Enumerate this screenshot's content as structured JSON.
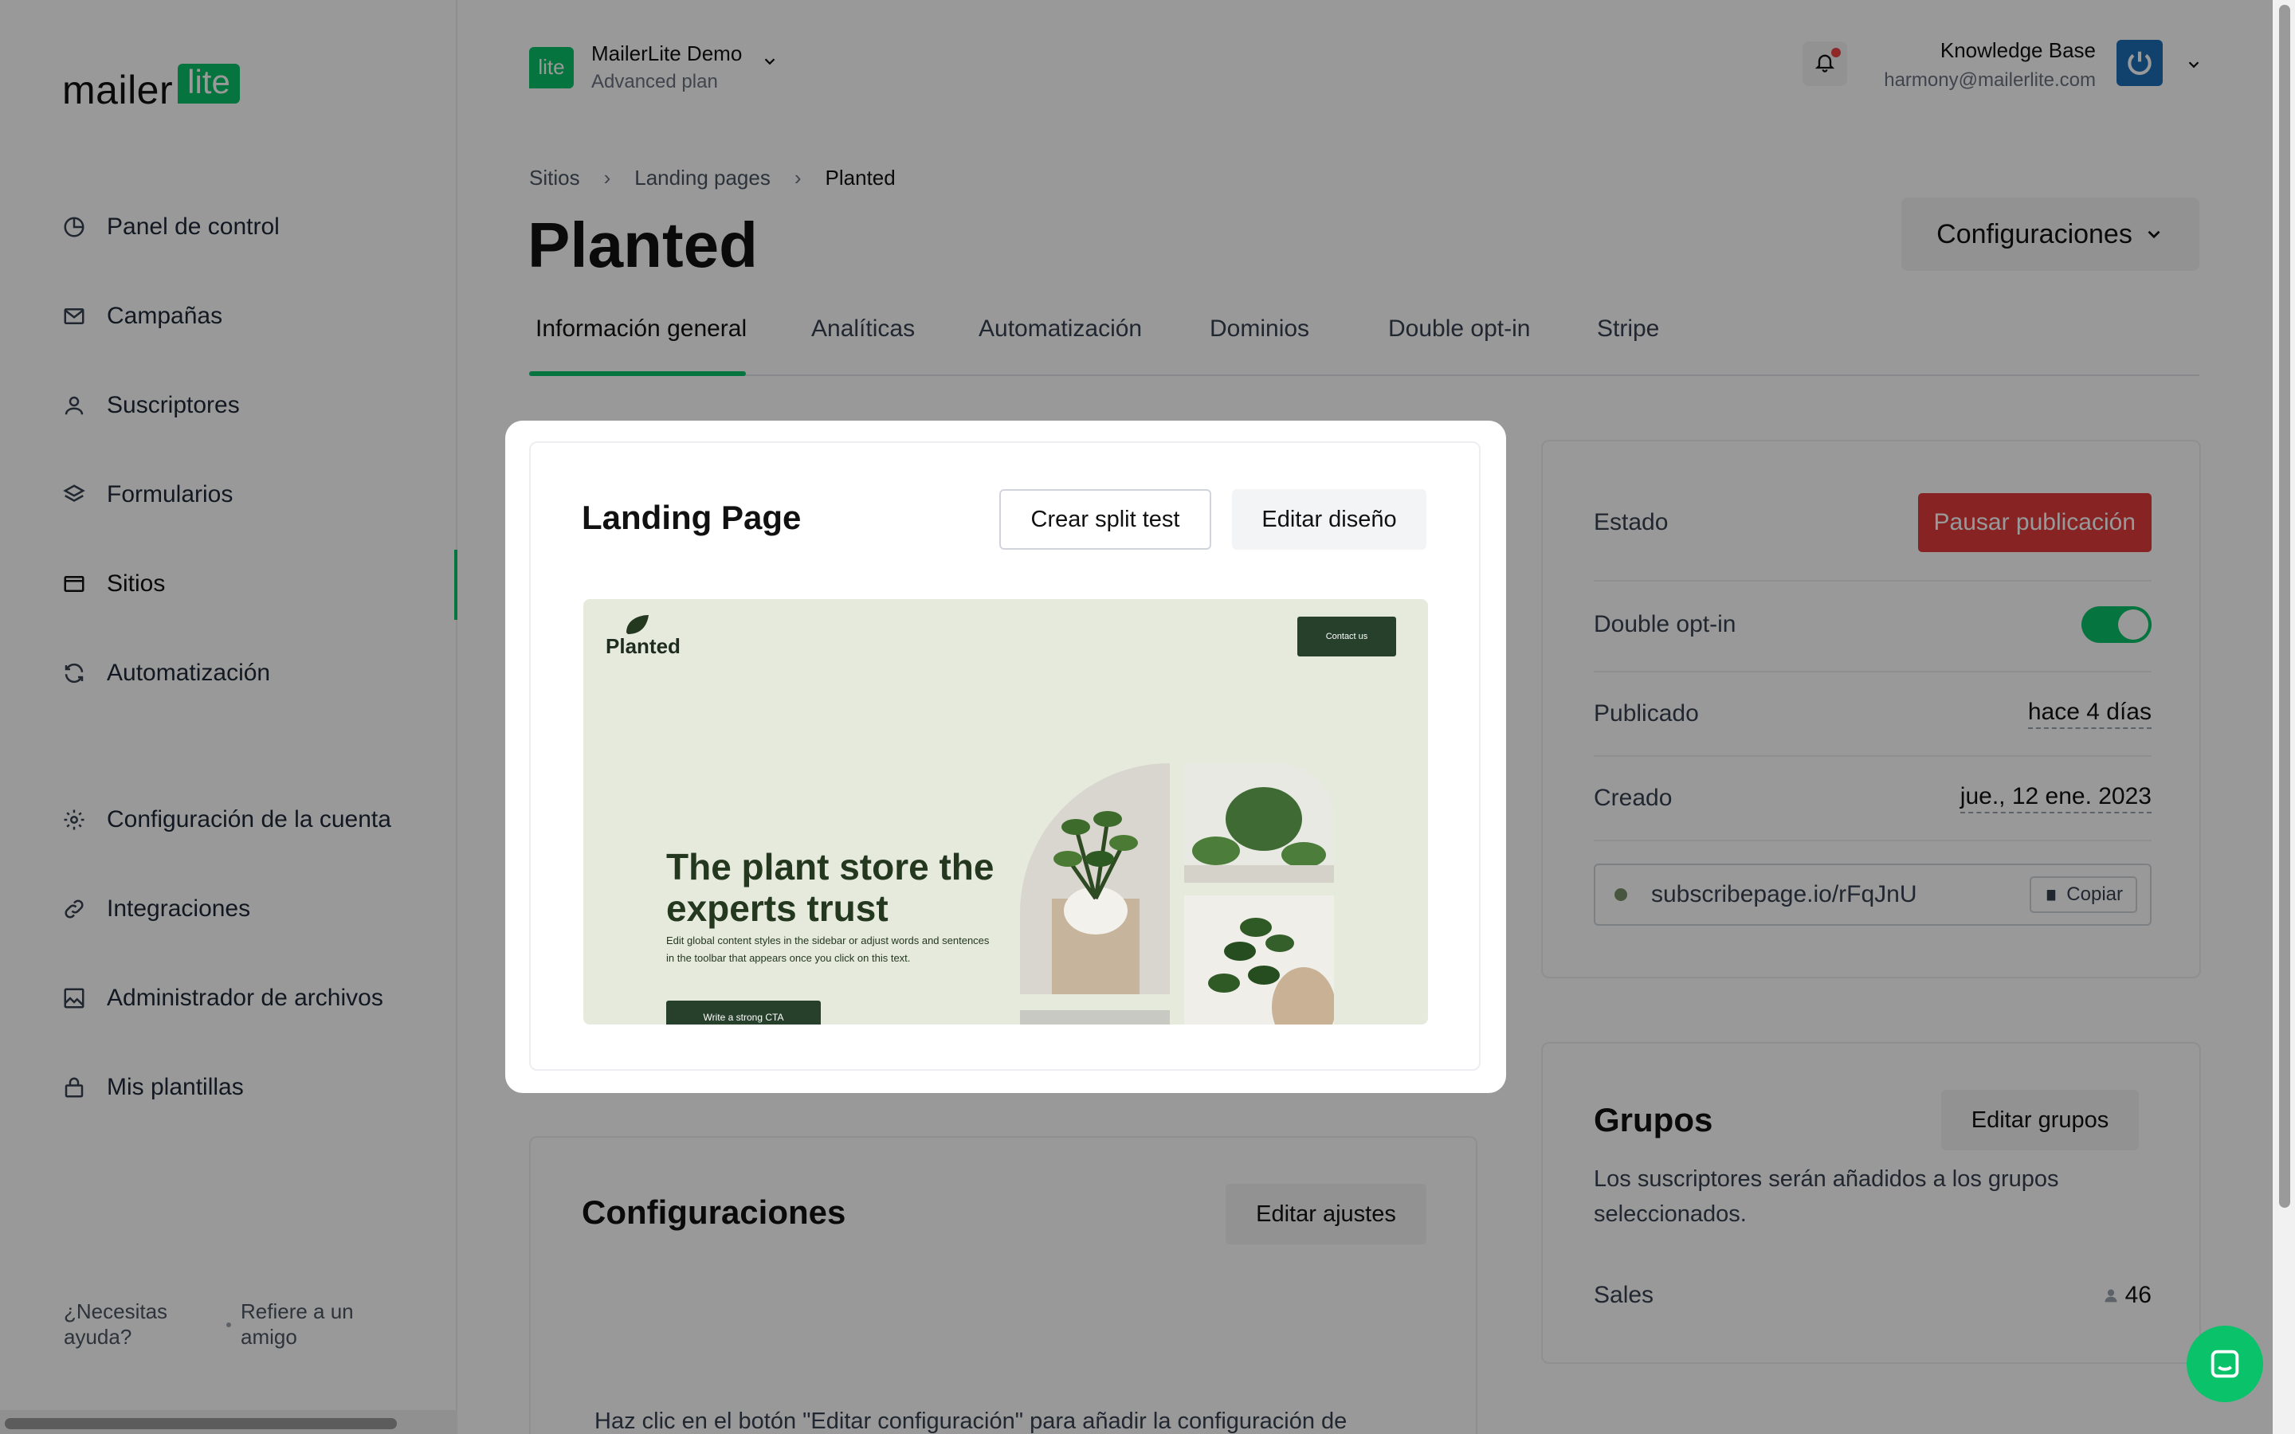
{
  "sidebar": {
    "logo_text": "mailer",
    "logo_badge": "lite",
    "items": [
      {
        "label": "Panel de control",
        "icon": "clock-icon"
      },
      {
        "label": "Campañas",
        "icon": "mail-icon"
      },
      {
        "label": "Suscriptores",
        "icon": "user-icon"
      },
      {
        "label": "Formularios",
        "icon": "layers-icon"
      },
      {
        "label": "Sitios",
        "icon": "browser-icon",
        "active": true
      },
      {
        "label": "Automatización",
        "icon": "refresh-icon"
      },
      {
        "label": "Configuración de la cuenta",
        "icon": "gear-icon"
      },
      {
        "label": "Integraciones",
        "icon": "link-icon"
      },
      {
        "label": "Administrador de archivos",
        "icon": "image-icon"
      },
      {
        "label": "Mis plantillas",
        "icon": "lock-icon"
      }
    ],
    "help": "¿Necesitas ayuda?",
    "refer": "Refiere a un amigo"
  },
  "header": {
    "account_badge": "lite",
    "account_name": "MailerLite Demo",
    "account_plan": "Advanced plan",
    "user_name": "Knowledge Base",
    "user_email": "harmony@mailerlite.com"
  },
  "breadcrumbs": [
    "Sitios",
    "Landing pages",
    "Planted"
  ],
  "page_title": "Planted",
  "config_button": "Configuraciones",
  "tabs": [
    "Información general",
    "Analíticas",
    "Automatización",
    "Dominios",
    "Double opt-in",
    "Stripe"
  ],
  "landing_card": {
    "title": "Landing Page",
    "split_test_button": "Crear split test",
    "edit_design_button": "Editar diseño",
    "preview": {
      "logo": "Planted",
      "contact": "Contact us",
      "headline": "The plant store the experts trust",
      "body": "Edit global content styles in the sidebar or adjust words and sentences in the toolbar that appears once you click on this text.",
      "cta": "Write a strong CTA"
    }
  },
  "config_card": {
    "title": "Configuraciones",
    "edit_button": "Editar ajustes",
    "hint": "Haz clic en el botón \"Editar configuración\" para añadir la configuración de"
  },
  "status_card": {
    "estado_label": "Estado",
    "pause_button": "Pausar publicación",
    "double_optin_label": "Double opt-in",
    "double_optin_enabled": true,
    "published_label": "Publicado",
    "published_value": "hace 4 días",
    "created_label": "Creado",
    "created_value": "jue., 12 ene. 2023",
    "url": "subscribepage.io/rFqJnU",
    "copy_button": "Copiar"
  },
  "groups_card": {
    "title": "Grupos",
    "edit_button": "Editar grupos",
    "description": "Los suscriptores serán añadidos a los grupos seleccionados.",
    "groups": [
      {
        "name": "Sales",
        "count": "46"
      }
    ]
  },
  "colors": {
    "brand": "#09c269",
    "danger": "#e33b3b"
  }
}
